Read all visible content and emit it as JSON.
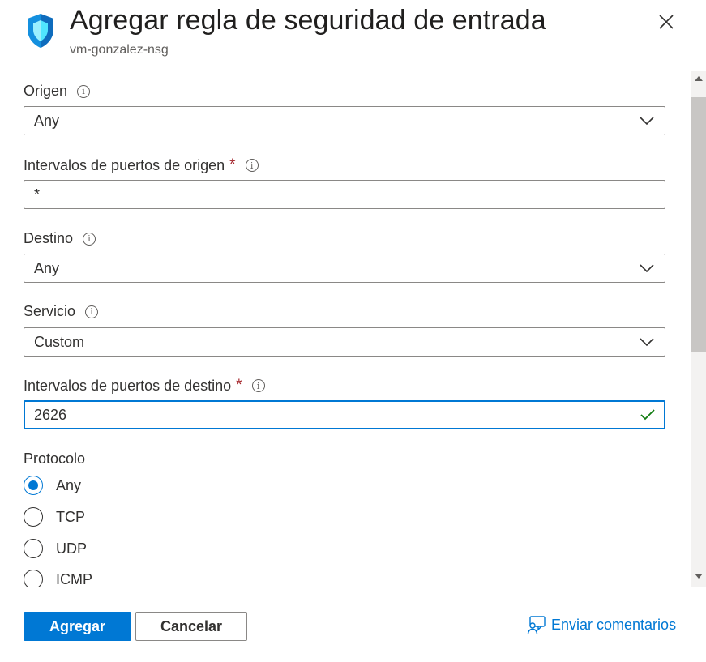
{
  "panel": {
    "title": "Agregar regla de seguridad de entrada",
    "subtitle": "vm-gonzalez-nsg"
  },
  "form": {
    "origen": {
      "label": "Origen",
      "value": "Any"
    },
    "puertos_origen": {
      "label": "Intervalos de puertos de origen",
      "required": "*",
      "value": "*"
    },
    "destino": {
      "label": "Destino",
      "value": "Any"
    },
    "servicio": {
      "label": "Servicio",
      "value": "Custom"
    },
    "puertos_destino": {
      "label": "Intervalos de puertos de destino",
      "required": "*",
      "value": "2626"
    },
    "protocolo": {
      "label": "Protocolo",
      "selected": "Any",
      "options": [
        "Any",
        "TCP",
        "UDP",
        "ICMP"
      ]
    },
    "info_glyph": "i"
  },
  "footer": {
    "add_label": "Agregar",
    "cancel_label": "Cancelar",
    "feedback_label": "Enviar comentarios"
  },
  "icons": {
    "header": "shield-icon",
    "close": "close-icon",
    "dropdown": "chevron-down-icon",
    "valid": "checkmark-icon",
    "info": "info-icon",
    "feedback": "feedback-icon"
  },
  "colors": {
    "accent": "#0078d4",
    "required": "#a4262c",
    "valid": "#107c10",
    "border": "#8a8886",
    "text": "#323130"
  }
}
